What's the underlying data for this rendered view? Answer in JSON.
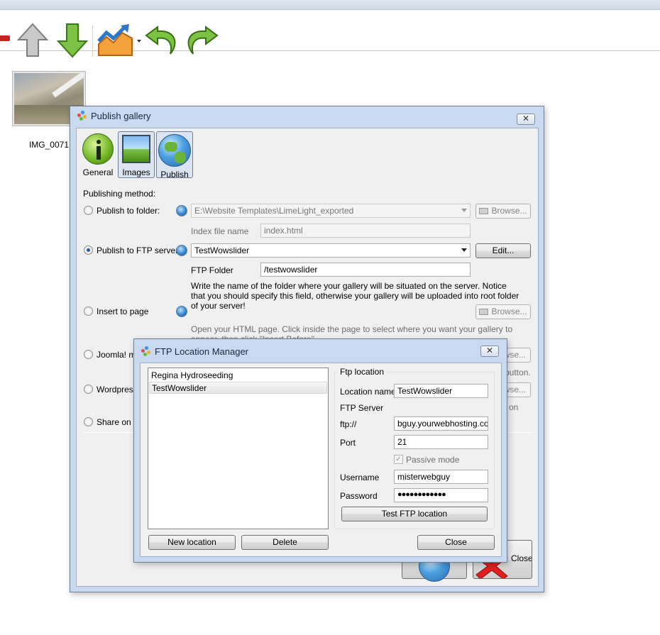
{
  "thumbnail": {
    "caption": "IMG_0071"
  },
  "publish_dialog": {
    "title": "Publish gallery",
    "close_glyph": "✕",
    "tabs": [
      {
        "label": "General"
      },
      {
        "label": "Images"
      },
      {
        "label": "Publish"
      }
    ],
    "publishing_method_label": "Publishing method:",
    "folder": {
      "radio_label": "Publish to folder:",
      "path_value": "E:\\Website Templates\\LimeLight_exported",
      "browse_label": "Browse...",
      "index_label": "Index file name",
      "index_value": "index.html"
    },
    "ftp": {
      "radio_label": "Publish to FTP server",
      "server_value": "TestWowslider",
      "edit_label": "Edit...",
      "folder_label": "FTP Folder",
      "folder_value": "/testwowslider",
      "hint": "Write the name of the folder where your gallery will be situated on the server. Notice that you should specify this field, otherwise your gallery will be uploaded into root folder of your server!"
    },
    "insert": {
      "radio_label": "Insert to page",
      "browse_label": "Browse...",
      "hint": "Open your HTML page. Click inside the page to select where you want your gallery to appear, then click \"Insert Before\""
    },
    "joomla": {
      "radio_label": "Joomla! mo",
      "browse_label": "wse...",
      "hint_tail": "button."
    },
    "wordpress": {
      "radio_label": "Wordpress",
      "browse_label": "wse...",
      "hint_tail": "on"
    },
    "share": {
      "radio_label": "Share on Fa"
    },
    "close_label": "Close"
  },
  "ftp_manager": {
    "title": "FTP Location Manager",
    "close_glyph": "✕",
    "locations": [
      "Regina Hydroseeding",
      "TestWowslider"
    ],
    "selected_index": 1,
    "group_title": "Ftp location",
    "location_name_label": "Location name",
    "location_name_value": "TestWowslider",
    "ftp_server_label": "FTP Server",
    "ftp_prefix": "ftp://",
    "host_value": "bguy.yourwebhosting.com",
    "port_label": "Port",
    "port_value": "21",
    "passive_label": "Passive mode",
    "passive_checked": true,
    "username_label": "Username",
    "username_value": "misterwebguy",
    "password_label": "Password",
    "password_value": "●●●●●●●●●●●●",
    "test_label": "Test FTP location",
    "new_label": "New location",
    "delete_label": "Delete",
    "close_label": "Close"
  }
}
